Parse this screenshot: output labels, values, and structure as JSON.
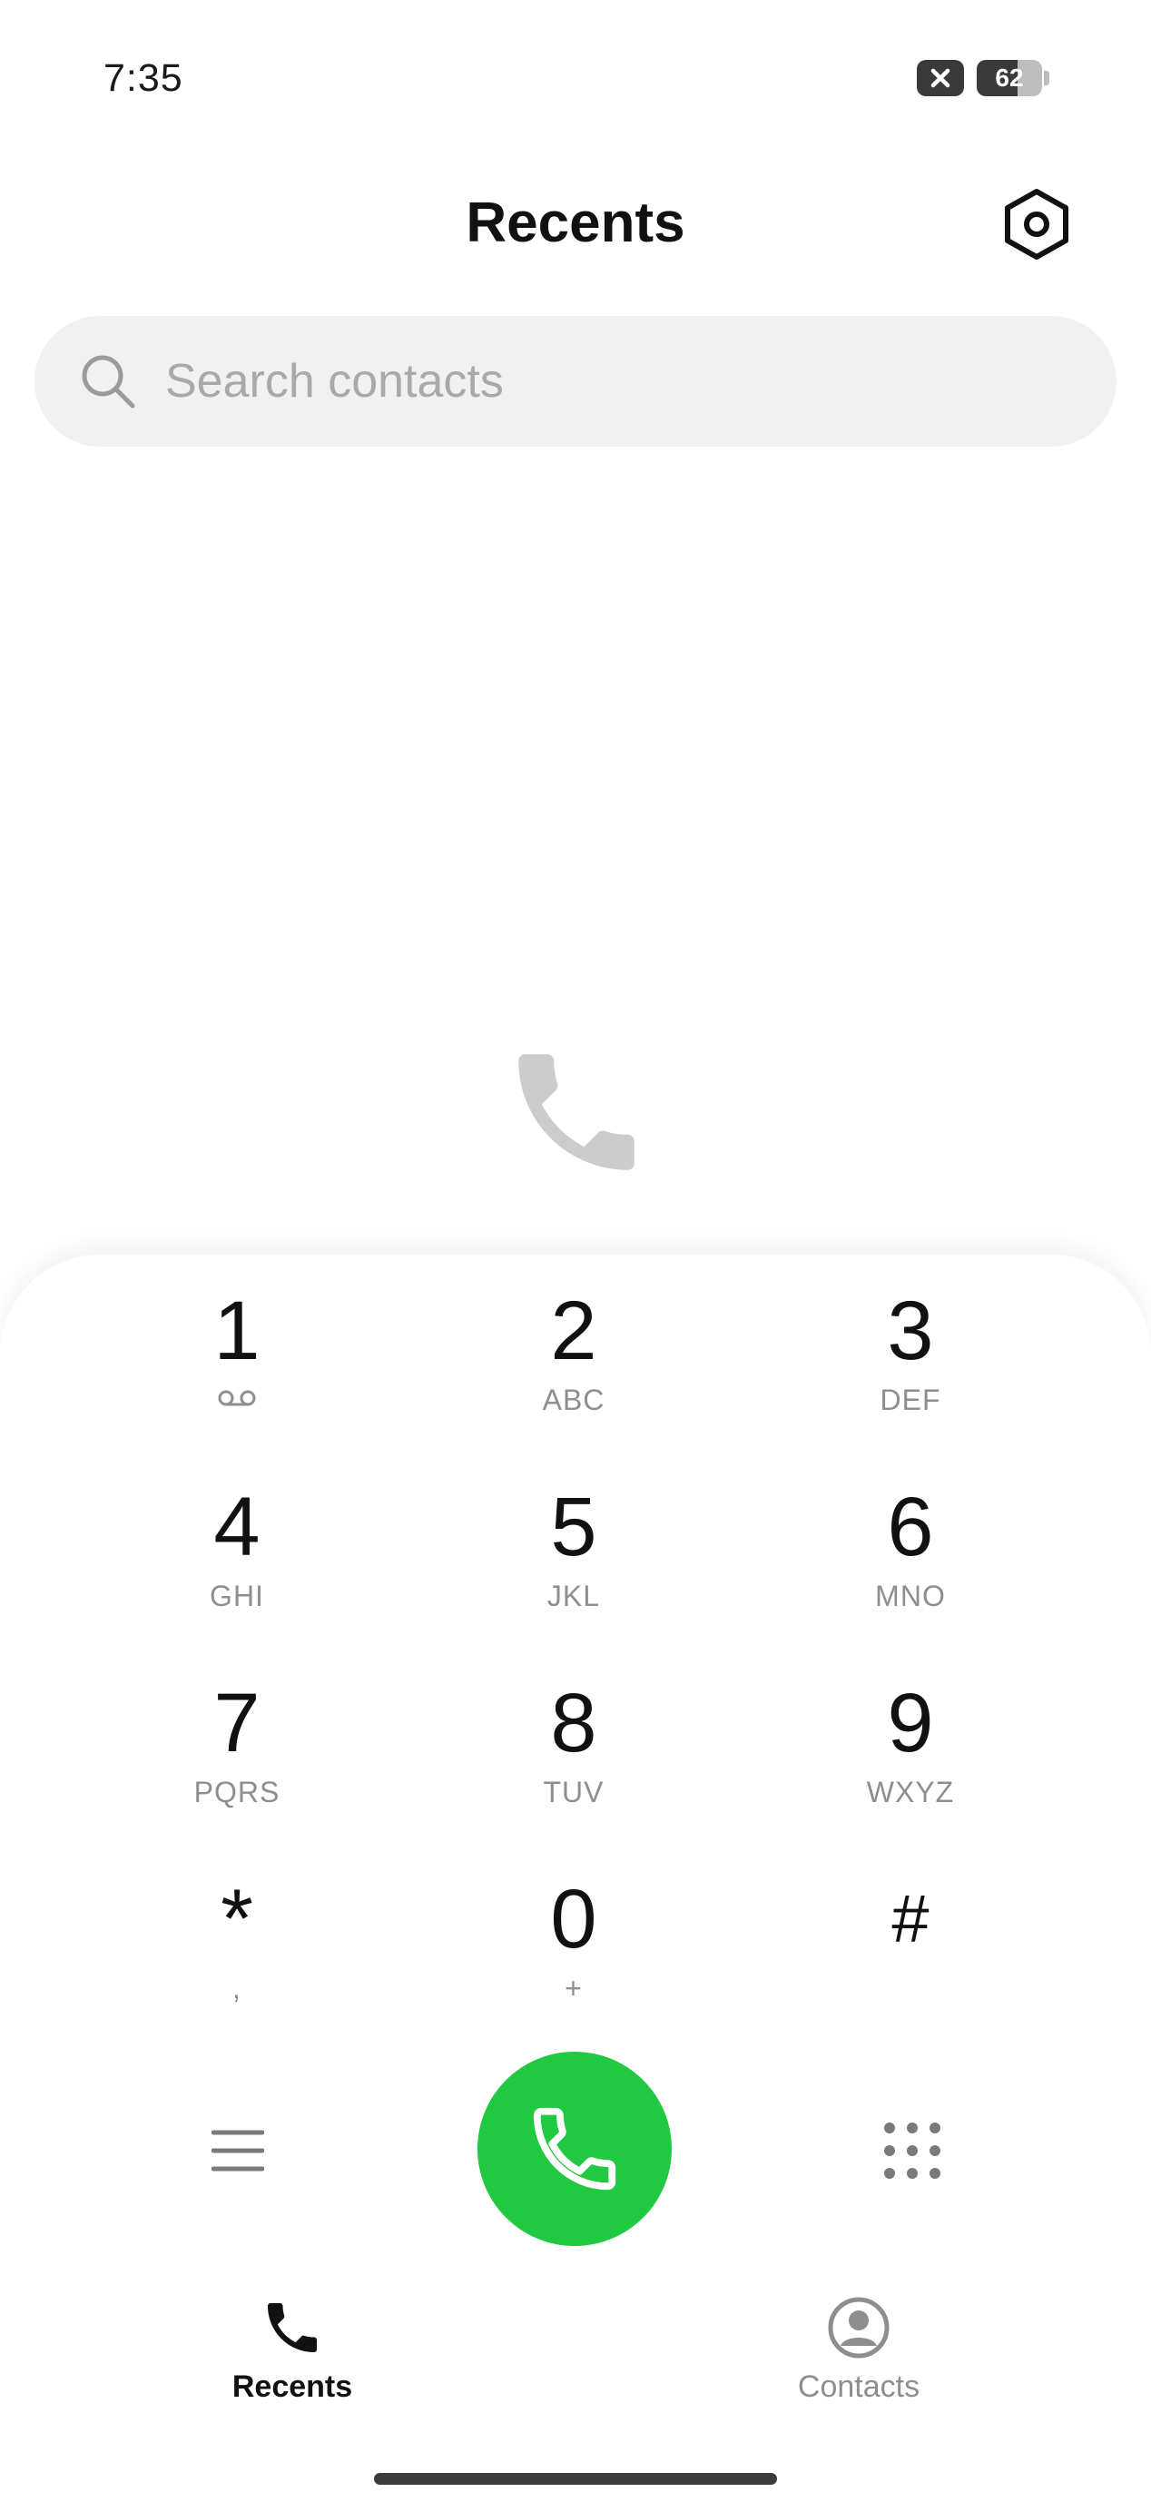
{
  "status_bar": {
    "time": "7:35",
    "battery_level": "62",
    "battery_fraction": 0.62,
    "icons": [
      "sim-x-icon",
      "battery-icon"
    ]
  },
  "header": {
    "title": "Recents",
    "settings_icon": "settings-hexagon-icon"
  },
  "search": {
    "placeholder": "Search contacts",
    "value": "",
    "icon": "search-icon"
  },
  "empty_state": {
    "icon": "phone-icon"
  },
  "dialpad": {
    "keys": [
      {
        "digit": "1",
        "letters": ""
      },
      {
        "digit": "2",
        "letters": "ABC"
      },
      {
        "digit": "3",
        "letters": "DEF"
      },
      {
        "digit": "4",
        "letters": "GHI"
      },
      {
        "digit": "5",
        "letters": "JKL"
      },
      {
        "digit": "6",
        "letters": "MNO"
      },
      {
        "digit": "7",
        "letters": "PQRS"
      },
      {
        "digit": "8",
        "letters": "TUV"
      },
      {
        "digit": "9",
        "letters": "WXYZ"
      },
      {
        "digit": "*",
        "letters": ","
      },
      {
        "digit": "0",
        "letters": "+"
      },
      {
        "digit": "#",
        "letters": ""
      }
    ]
  },
  "actions": {
    "menu_icon": "menu-icon",
    "call_icon": "phone-icon",
    "dialpad_icon": "dialpad-grid-icon",
    "call_color": "#21c941"
  },
  "tabs": [
    {
      "label": "Recents",
      "active": true,
      "icon": "phone-icon"
    },
    {
      "label": "Contacts",
      "active": false,
      "icon": "contact-person-icon"
    }
  ],
  "colors": {
    "accent_green": "#21c941",
    "search_bg": "#f1f1f1",
    "secondary_text": "#8e8e8e"
  }
}
